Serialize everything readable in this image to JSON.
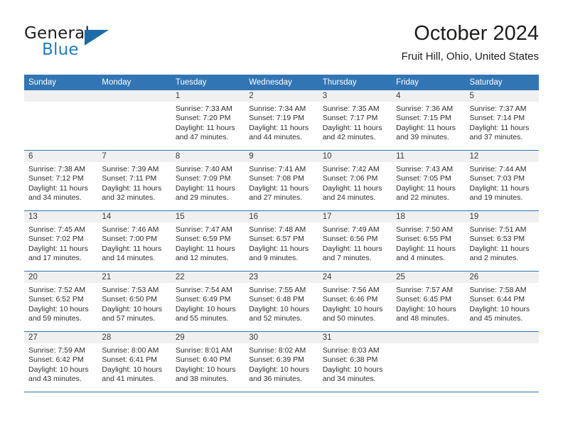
{
  "brand": {
    "name_top": "General",
    "name_bottom": "Blue",
    "logo_icon": "triangle-icon",
    "color_primary": "#1b6ca8",
    "color_text": "#1d1d1b"
  },
  "header": {
    "title": "October 2024",
    "subtitle": "Fruit Hill, Ohio, United States"
  },
  "calendar": {
    "header_bg": "#3275b4",
    "header_text_color": "#ffffff",
    "daynum_band_bg": "#f0f0f0",
    "row_separator_color": "#3275b4",
    "weekday_headers": [
      "Sunday",
      "Monday",
      "Tuesday",
      "Wednesday",
      "Thursday",
      "Friday",
      "Saturday"
    ],
    "weeks": [
      [
        {
          "day": "",
          "sunrise": "",
          "sunset": "",
          "daylight_line1": "",
          "daylight_line2": ""
        },
        {
          "day": "",
          "sunrise": "",
          "sunset": "",
          "daylight_line1": "",
          "daylight_line2": ""
        },
        {
          "day": "1",
          "sunrise": "Sunrise: 7:33 AM",
          "sunset": "Sunset: 7:20 PM",
          "daylight_line1": "Daylight: 11 hours",
          "daylight_line2": "and 47 minutes."
        },
        {
          "day": "2",
          "sunrise": "Sunrise: 7:34 AM",
          "sunset": "Sunset: 7:19 PM",
          "daylight_line1": "Daylight: 11 hours",
          "daylight_line2": "and 44 minutes."
        },
        {
          "day": "3",
          "sunrise": "Sunrise: 7:35 AM",
          "sunset": "Sunset: 7:17 PM",
          "daylight_line1": "Daylight: 11 hours",
          "daylight_line2": "and 42 minutes."
        },
        {
          "day": "4",
          "sunrise": "Sunrise: 7:36 AM",
          "sunset": "Sunset: 7:15 PM",
          "daylight_line1": "Daylight: 11 hours",
          "daylight_line2": "and 39 minutes."
        },
        {
          "day": "5",
          "sunrise": "Sunrise: 7:37 AM",
          "sunset": "Sunset: 7:14 PM",
          "daylight_line1": "Daylight: 11 hours",
          "daylight_line2": "and 37 minutes."
        }
      ],
      [
        {
          "day": "6",
          "sunrise": "Sunrise: 7:38 AM",
          "sunset": "Sunset: 7:12 PM",
          "daylight_line1": "Daylight: 11 hours",
          "daylight_line2": "and 34 minutes."
        },
        {
          "day": "7",
          "sunrise": "Sunrise: 7:39 AM",
          "sunset": "Sunset: 7:11 PM",
          "daylight_line1": "Daylight: 11 hours",
          "daylight_line2": "and 32 minutes."
        },
        {
          "day": "8",
          "sunrise": "Sunrise: 7:40 AM",
          "sunset": "Sunset: 7:09 PM",
          "daylight_line1": "Daylight: 11 hours",
          "daylight_line2": "and 29 minutes."
        },
        {
          "day": "9",
          "sunrise": "Sunrise: 7:41 AM",
          "sunset": "Sunset: 7:08 PM",
          "daylight_line1": "Daylight: 11 hours",
          "daylight_line2": "and 27 minutes."
        },
        {
          "day": "10",
          "sunrise": "Sunrise: 7:42 AM",
          "sunset": "Sunset: 7:06 PM",
          "daylight_line1": "Daylight: 11 hours",
          "daylight_line2": "and 24 minutes."
        },
        {
          "day": "11",
          "sunrise": "Sunrise: 7:43 AM",
          "sunset": "Sunset: 7:05 PM",
          "daylight_line1": "Daylight: 11 hours",
          "daylight_line2": "and 22 minutes."
        },
        {
          "day": "12",
          "sunrise": "Sunrise: 7:44 AM",
          "sunset": "Sunset: 7:03 PM",
          "daylight_line1": "Daylight: 11 hours",
          "daylight_line2": "and 19 minutes."
        }
      ],
      [
        {
          "day": "13",
          "sunrise": "Sunrise: 7:45 AM",
          "sunset": "Sunset: 7:02 PM",
          "daylight_line1": "Daylight: 11 hours",
          "daylight_line2": "and 17 minutes."
        },
        {
          "day": "14",
          "sunrise": "Sunrise: 7:46 AM",
          "sunset": "Sunset: 7:00 PM",
          "daylight_line1": "Daylight: 11 hours",
          "daylight_line2": "and 14 minutes."
        },
        {
          "day": "15",
          "sunrise": "Sunrise: 7:47 AM",
          "sunset": "Sunset: 6:59 PM",
          "daylight_line1": "Daylight: 11 hours",
          "daylight_line2": "and 12 minutes."
        },
        {
          "day": "16",
          "sunrise": "Sunrise: 7:48 AM",
          "sunset": "Sunset: 6:57 PM",
          "daylight_line1": "Daylight: 11 hours",
          "daylight_line2": "and 9 minutes."
        },
        {
          "day": "17",
          "sunrise": "Sunrise: 7:49 AM",
          "sunset": "Sunset: 6:56 PM",
          "daylight_line1": "Daylight: 11 hours",
          "daylight_line2": "and 7 minutes."
        },
        {
          "day": "18",
          "sunrise": "Sunrise: 7:50 AM",
          "sunset": "Sunset: 6:55 PM",
          "daylight_line1": "Daylight: 11 hours",
          "daylight_line2": "and 4 minutes."
        },
        {
          "day": "19",
          "sunrise": "Sunrise: 7:51 AM",
          "sunset": "Sunset: 6:53 PM",
          "daylight_line1": "Daylight: 11 hours",
          "daylight_line2": "and 2 minutes."
        }
      ],
      [
        {
          "day": "20",
          "sunrise": "Sunrise: 7:52 AM",
          "sunset": "Sunset: 6:52 PM",
          "daylight_line1": "Daylight: 10 hours",
          "daylight_line2": "and 59 minutes."
        },
        {
          "day": "21",
          "sunrise": "Sunrise: 7:53 AM",
          "sunset": "Sunset: 6:50 PM",
          "daylight_line1": "Daylight: 10 hours",
          "daylight_line2": "and 57 minutes."
        },
        {
          "day": "22",
          "sunrise": "Sunrise: 7:54 AM",
          "sunset": "Sunset: 6:49 PM",
          "daylight_line1": "Daylight: 10 hours",
          "daylight_line2": "and 55 minutes."
        },
        {
          "day": "23",
          "sunrise": "Sunrise: 7:55 AM",
          "sunset": "Sunset: 6:48 PM",
          "daylight_line1": "Daylight: 10 hours",
          "daylight_line2": "and 52 minutes."
        },
        {
          "day": "24",
          "sunrise": "Sunrise: 7:56 AM",
          "sunset": "Sunset: 6:46 PM",
          "daylight_line1": "Daylight: 10 hours",
          "daylight_line2": "and 50 minutes."
        },
        {
          "day": "25",
          "sunrise": "Sunrise: 7:57 AM",
          "sunset": "Sunset: 6:45 PM",
          "daylight_line1": "Daylight: 10 hours",
          "daylight_line2": "and 48 minutes."
        },
        {
          "day": "26",
          "sunrise": "Sunrise: 7:58 AM",
          "sunset": "Sunset: 6:44 PM",
          "daylight_line1": "Daylight: 10 hours",
          "daylight_line2": "and 45 minutes."
        }
      ],
      [
        {
          "day": "27",
          "sunrise": "Sunrise: 7:59 AM",
          "sunset": "Sunset: 6:42 PM",
          "daylight_line1": "Daylight: 10 hours",
          "daylight_line2": "and 43 minutes."
        },
        {
          "day": "28",
          "sunrise": "Sunrise: 8:00 AM",
          "sunset": "Sunset: 6:41 PM",
          "daylight_line1": "Daylight: 10 hours",
          "daylight_line2": "and 41 minutes."
        },
        {
          "day": "29",
          "sunrise": "Sunrise: 8:01 AM",
          "sunset": "Sunset: 6:40 PM",
          "daylight_line1": "Daylight: 10 hours",
          "daylight_line2": "and 38 minutes."
        },
        {
          "day": "30",
          "sunrise": "Sunrise: 8:02 AM",
          "sunset": "Sunset: 6:39 PM",
          "daylight_line1": "Daylight: 10 hours",
          "daylight_line2": "and 36 minutes."
        },
        {
          "day": "31",
          "sunrise": "Sunrise: 8:03 AM",
          "sunset": "Sunset: 6:38 PM",
          "daylight_line1": "Daylight: 10 hours",
          "daylight_line2": "and 34 minutes."
        },
        {
          "day": "",
          "sunrise": "",
          "sunset": "",
          "daylight_line1": "",
          "daylight_line2": ""
        },
        {
          "day": "",
          "sunrise": "",
          "sunset": "",
          "daylight_line1": "",
          "daylight_line2": ""
        }
      ]
    ]
  }
}
